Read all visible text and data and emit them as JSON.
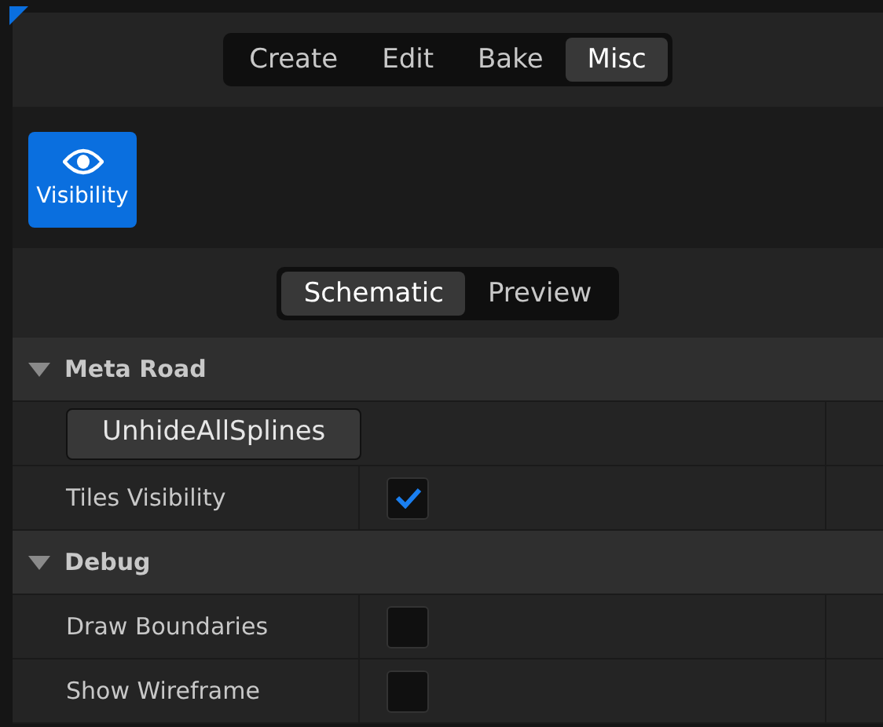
{
  "mode_tabs": [
    {
      "label": "Create",
      "selected": false
    },
    {
      "label": "Edit",
      "selected": false
    },
    {
      "label": "Bake",
      "selected": false
    },
    {
      "label": "Misc",
      "selected": true
    }
  ],
  "tools": [
    {
      "label": "Visibility",
      "selected": true
    }
  ],
  "view_tabs": [
    {
      "label": "Schematic",
      "selected": true
    },
    {
      "label": "Preview",
      "selected": false
    }
  ],
  "sections": [
    {
      "title": "Meta Road",
      "expanded": true,
      "rows": [
        {
          "kind": "button",
          "label": "UnhideAllSplines"
        },
        {
          "kind": "checkbox",
          "label": "Tiles Visibility",
          "checked": true
        }
      ]
    },
    {
      "title": "Debug",
      "expanded": true,
      "rows": [
        {
          "kind": "checkbox",
          "label": "Draw Boundaries",
          "checked": false
        },
        {
          "kind": "checkbox",
          "label": "Show Wireframe",
          "checked": false
        }
      ]
    }
  ]
}
